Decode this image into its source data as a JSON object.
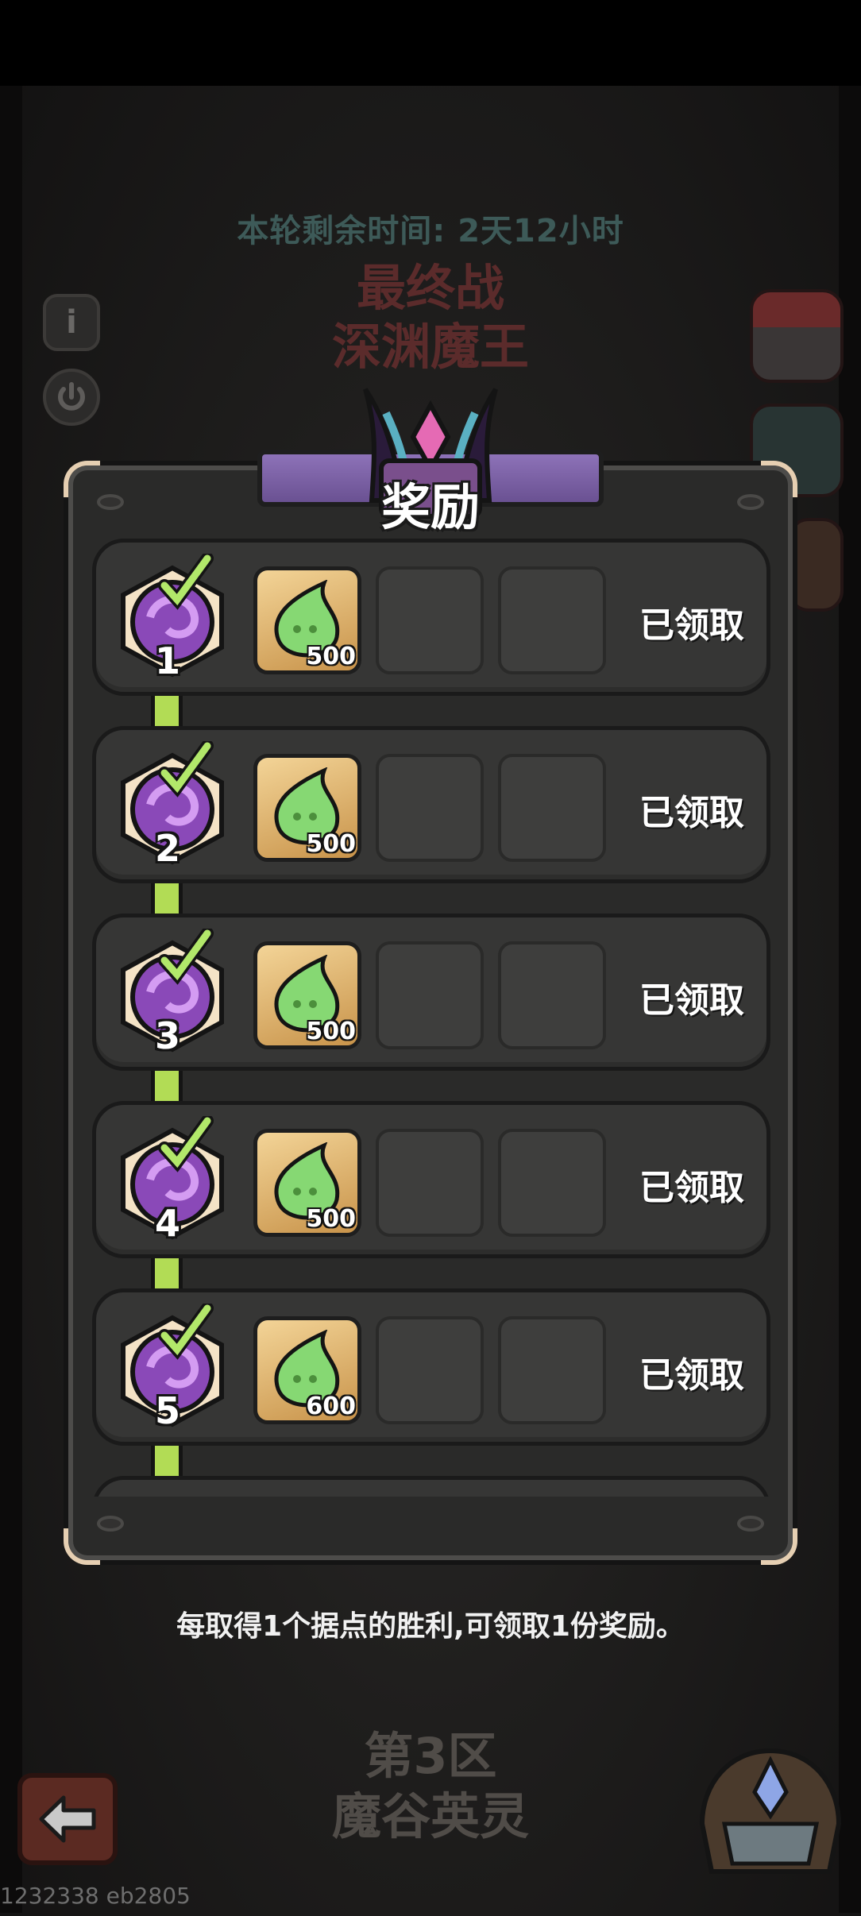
{
  "timer_label": "本轮剩余时间: 2天12小时",
  "stage": {
    "line1": "最终战",
    "line2": "深渊魔王"
  },
  "panel": {
    "title": "奖励"
  },
  "rewards": [
    {
      "number": "1",
      "item": "green-slime-essence",
      "qty": "500",
      "status": "已领取",
      "claimed": true
    },
    {
      "number": "2",
      "item": "green-slime-essence",
      "qty": "500",
      "status": "已领取",
      "claimed": true
    },
    {
      "number": "3",
      "item": "green-slime-essence",
      "qty": "500",
      "status": "已领取",
      "claimed": true
    },
    {
      "number": "4",
      "item": "green-slime-essence",
      "qty": "500",
      "status": "已领取",
      "claimed": true
    },
    {
      "number": "5",
      "item": "green-slime-essence",
      "qty": "600",
      "status": "已领取",
      "claimed": true
    }
  ],
  "footnote": "每取得1个据点的胜利,可领取1份奖励。",
  "zone": {
    "line1": "第3区",
    "line2": "魔谷英灵"
  },
  "watermark": "1232338 eb2805",
  "icons": {
    "info": "info-icon",
    "power": "power-icon",
    "back": "back-arrow-icon",
    "shop": "shop-icon",
    "book": "book-icon",
    "cake": "cake-icon",
    "helmet": "helmet-icon",
    "crown": "crown-icon",
    "check": "check-icon"
  },
  "colors": {
    "track": "#b2dc55",
    "banner": "#7b60a6",
    "item_bg": "#e6b86d",
    "slime": "#86d873"
  }
}
